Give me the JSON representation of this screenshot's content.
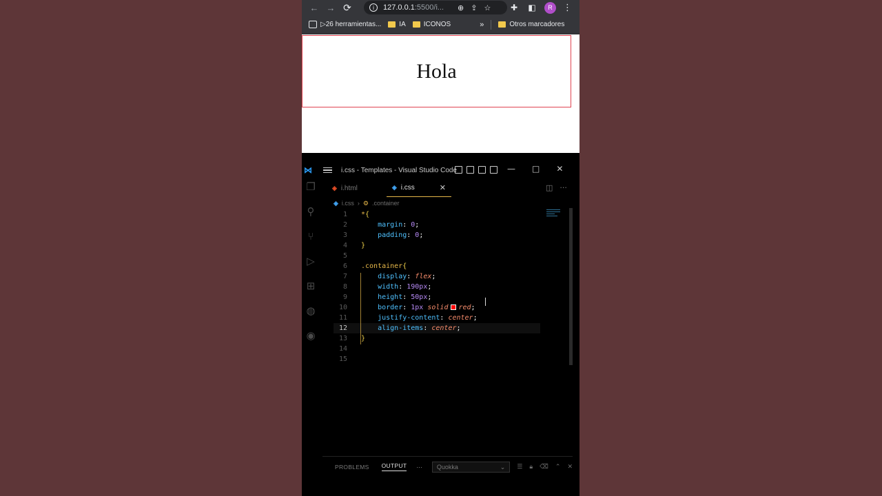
{
  "browser": {
    "url_host": "127.0.0.1",
    "url_rest": ":5500/i...",
    "avatar_letter": "R",
    "bookmarks": [
      {
        "label": "▷26 herramientas..."
      },
      {
        "label": "IA"
      },
      {
        "label": "ICONOS"
      }
    ],
    "other_bookmarks": "Otros marcadores"
  },
  "page": {
    "heading": "Hola"
  },
  "vscode": {
    "window_title": "i.css - Templates - Visual Studio Code",
    "tabs": [
      {
        "label": "i.html",
        "active": false
      },
      {
        "label": "i.css",
        "active": true
      }
    ],
    "breadcrumb": {
      "file": "i.css",
      "symbol": ".container"
    },
    "panel": {
      "tabs": [
        "PROBLEMS",
        "OUTPUT"
      ],
      "active_tab": "OUTPUT",
      "more": "···",
      "output_channel": "Quokka"
    }
  },
  "colors": {
    "container_border": "#e0424f",
    "accent_tab": "#e7b84a",
    "color_swatch": "#ff0000"
  }
}
